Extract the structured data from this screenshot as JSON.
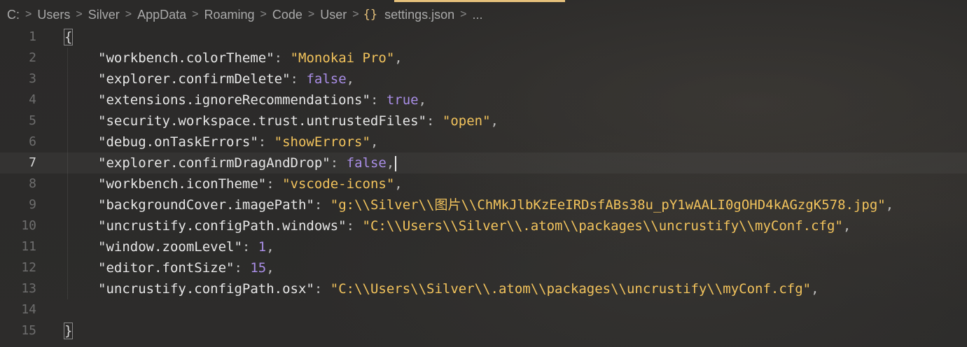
{
  "breadcrumb": [
    "C:",
    "Users",
    "Silver",
    "AppData",
    "Roaming",
    "Code",
    "User",
    "settings.json",
    "..."
  ],
  "breadcrumb_sep": ">",
  "json_icon": "{}",
  "lines": [
    {
      "num": "1",
      "open": "{"
    },
    {
      "num": "2",
      "key": "\"workbench.colorTheme\"",
      "vtype": "str",
      "value": "\"Monokai Pro\""
    },
    {
      "num": "3",
      "key": "\"explorer.confirmDelete\"",
      "vtype": "kw",
      "value": "false"
    },
    {
      "num": "4",
      "key": "\"extensions.ignoreRecommendations\"",
      "vtype": "kw",
      "value": "true"
    },
    {
      "num": "5",
      "key": "\"security.workspace.trust.untrustedFiles\"",
      "vtype": "str",
      "value": "\"open\""
    },
    {
      "num": "6",
      "key": "\"debug.onTaskErrors\"",
      "vtype": "str",
      "value": "\"showErrors\""
    },
    {
      "num": "7",
      "key": "\"explorer.confirmDragAndDrop\"",
      "vtype": "kw",
      "value": "false"
    },
    {
      "num": "8",
      "key": "\"workbench.iconTheme\"",
      "vtype": "str",
      "value": "\"vscode-icons\""
    },
    {
      "num": "9",
      "key": "\"backgroundCover.imagePath\"",
      "vtype": "str",
      "value": "\"g:\\\\Silver\\\\图片\\\\ChMkJlbKzEeIRDsfABs38u_pY1wAALI0gOHD4kAGzgK578.jpg\""
    },
    {
      "num": "10",
      "key": "\"uncrustify.configPath.windows\"",
      "vtype": "str",
      "value": "\"C:\\\\Users\\\\Silver\\\\.atom\\\\packages\\\\uncrustify\\\\myConf.cfg\""
    },
    {
      "num": "11",
      "key": "\"window.zoomLevel\"",
      "vtype": "num",
      "value": "1"
    },
    {
      "num": "12",
      "key": "\"editor.fontSize\"",
      "vtype": "num",
      "value": "15"
    },
    {
      "num": "13",
      "key": "\"uncrustify.configPath.osx\"",
      "vtype": "str",
      "value": "\"C:\\\\Users\\\\Silver\\\\.atom\\\\packages\\\\uncrustify\\\\myConf.cfg\""
    },
    {
      "num": "14"
    },
    {
      "num": "15",
      "close": "}"
    }
  ],
  "active_line": "7",
  "colors": {
    "string": "#f2c35c",
    "keyword": "#a98ee6",
    "accent": "#e5c07b"
  }
}
